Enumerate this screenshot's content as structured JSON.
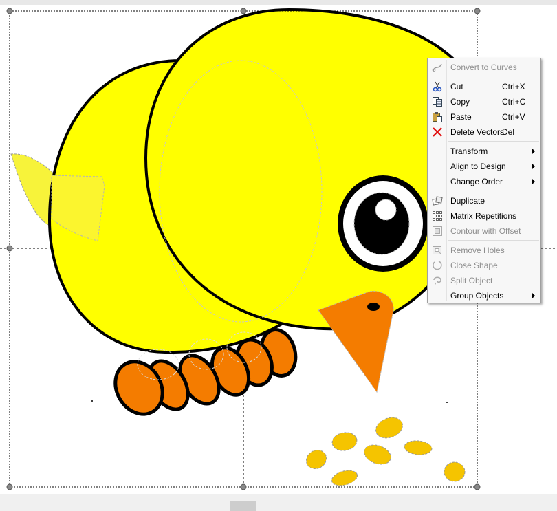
{
  "context_menu": {
    "items": [
      {
        "label": "Convert to Curves",
        "shortcut": "",
        "enabled": false,
        "submenu": false,
        "icon": "convert-to-curves-icon"
      },
      {
        "label": "Cut",
        "shortcut": "Ctrl+X",
        "enabled": true,
        "submenu": false,
        "icon": "scissors-icon"
      },
      {
        "label": "Copy",
        "shortcut": "Ctrl+C",
        "enabled": true,
        "submenu": false,
        "icon": "copy-icon"
      },
      {
        "label": "Paste",
        "shortcut": "Ctrl+V",
        "enabled": true,
        "submenu": false,
        "icon": "paste-icon"
      },
      {
        "label": "Delete Vectors",
        "shortcut": "Del",
        "enabled": true,
        "submenu": false,
        "icon": "delete-x-icon"
      },
      {
        "label": "Transform",
        "shortcut": "",
        "enabled": true,
        "submenu": true,
        "icon": ""
      },
      {
        "label": "Align to Design",
        "shortcut": "",
        "enabled": true,
        "submenu": true,
        "icon": ""
      },
      {
        "label": "Change Order",
        "shortcut": "",
        "enabled": true,
        "submenu": true,
        "icon": ""
      },
      {
        "label": "Duplicate",
        "shortcut": "",
        "enabled": true,
        "submenu": false,
        "icon": "duplicate-icon"
      },
      {
        "label": "Matrix Repetitions",
        "shortcut": "",
        "enabled": true,
        "submenu": false,
        "icon": "grid-icon"
      },
      {
        "label": "Contour with Offset",
        "shortcut": "",
        "enabled": false,
        "submenu": false,
        "icon": "contour-icon"
      },
      {
        "label": "Remove Holes",
        "shortcut": "",
        "enabled": false,
        "submenu": false,
        "icon": "remove-holes-icon"
      },
      {
        "label": "Close Shape",
        "shortcut": "",
        "enabled": false,
        "submenu": false,
        "icon": "close-shape-icon"
      },
      {
        "label": "Split Object",
        "shortcut": "",
        "enabled": false,
        "submenu": false,
        "icon": "split-object-icon"
      },
      {
        "label": "Group Objects",
        "shortcut": "",
        "enabled": true,
        "submenu": true,
        "icon": ""
      }
    ]
  },
  "artwork": {
    "subject": "yellow chick pecking grain",
    "colors": {
      "body": "#ffff00",
      "beak": "#f47c00",
      "feet": "#f47c00",
      "grain": "#f5c400",
      "outline": "#000000",
      "selection_dash": "#b5b5b5"
    }
  }
}
